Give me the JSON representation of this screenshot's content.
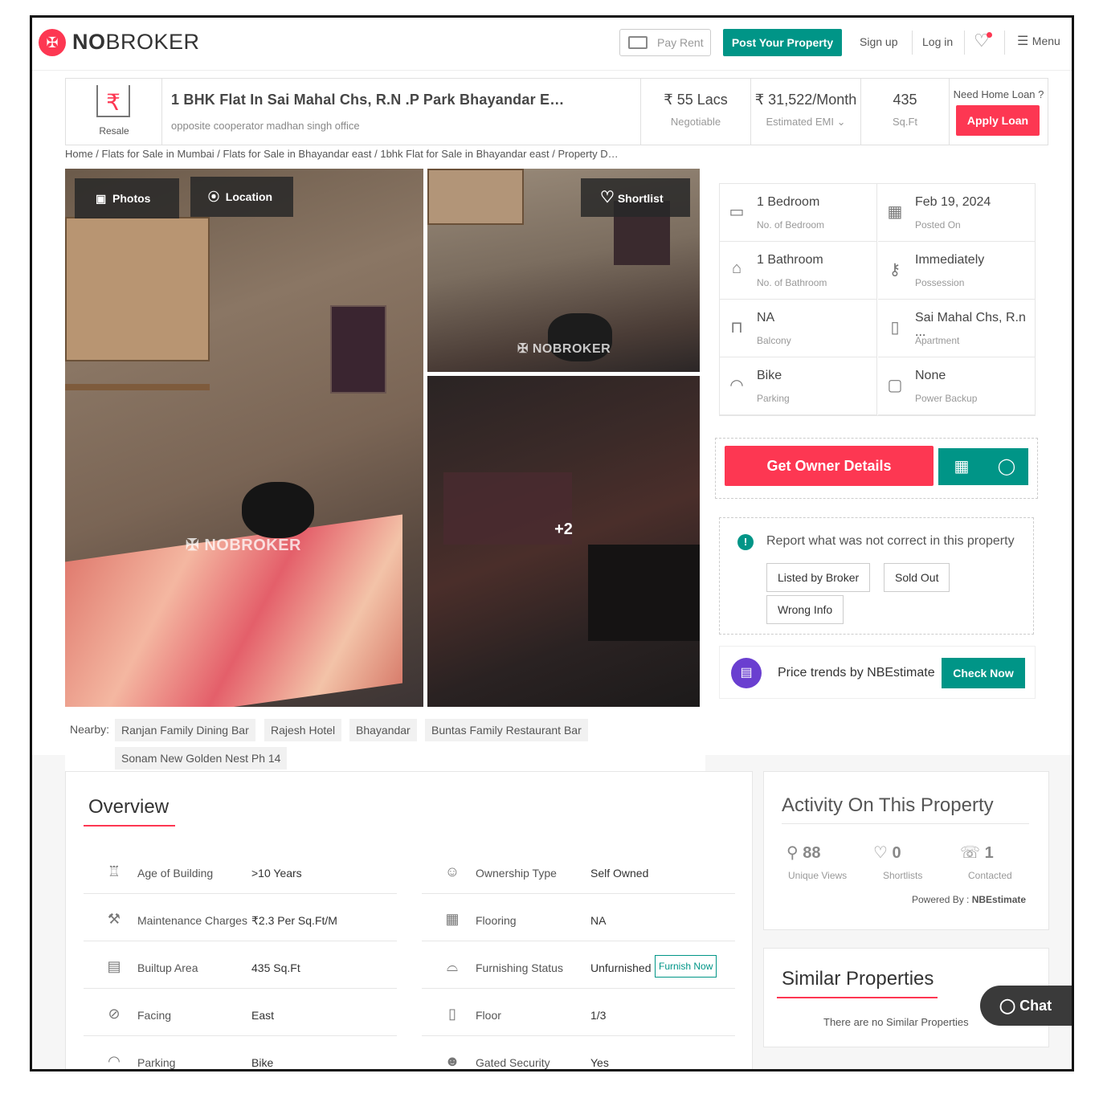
{
  "header": {
    "logo_text_bold": "NO",
    "logo_text_rest": "BROKER",
    "pay_rent": "Pay Rent",
    "post_property": "Post Your Property",
    "sign_up": "Sign up",
    "log_in": "Log in",
    "menu": "Menu"
  },
  "summary": {
    "tag": "Resale",
    "title": "1 BHK Flat In Sai Mahal Chs, R.N .P Park Bhayandar E…",
    "subtitle": "opposite cooperator madhan singh office",
    "price": "₹ 55 Lacs",
    "price_label": "Negotiable",
    "emi": "₹ 31,522/Month",
    "emi_label": "Estimated EMI",
    "area": "435",
    "area_label": "Sq.Ft",
    "loan_question": "Need Home Loan ?",
    "apply_loan": "Apply Loan"
  },
  "breadcrumb": "Home / Flats for Sale in Mumbai / Flats for Sale in Bhayandar east / 1bhk Flat for Sale in Bhayandar east / Property D…",
  "gallery": {
    "photos": "Photos",
    "location": "Location",
    "shortlist": "Shortlist",
    "more": "+2",
    "watermark": "NOBROKER"
  },
  "details": [
    {
      "value": "1 Bedroom",
      "label": "No. of Bedroom",
      "icon": "bed-icon"
    },
    {
      "value": "Feb 19, 2024",
      "label": "Posted On",
      "icon": "calendar-icon"
    },
    {
      "value": "1 Bathroom",
      "label": "No. of Bathroom",
      "icon": "bathtub-icon"
    },
    {
      "value": "Immediately",
      "label": "Possession",
      "icon": "key-icon"
    },
    {
      "value": "NA",
      "label": "Balcony",
      "icon": "balcony-icon"
    },
    {
      "value": "Sai Mahal Chs, R.n ...",
      "label": "Apartment",
      "icon": "building-icon"
    },
    {
      "value": "Bike",
      "label": "Parking",
      "icon": "car-icon"
    },
    {
      "value": "None",
      "label": "Power Backup",
      "icon": "battery-icon"
    }
  ],
  "cta": {
    "owner": "Get Owner Details"
  },
  "report": {
    "title": "Report what was not correct in this property",
    "options": [
      "Listed by Broker",
      "Sold Out",
      "Wrong Info"
    ]
  },
  "trend": {
    "text": "Price trends by NBEstimate",
    "button": "Check Now"
  },
  "nearby": {
    "label": "Nearby:",
    "places": [
      "Ranjan Family Dining Bar",
      "Rajesh Hotel",
      "Bhayandar",
      "Buntas Family Restaurant Bar",
      "Sonam New Golden Nest Ph 14"
    ]
  },
  "overview": {
    "title": "Overview",
    "left": [
      {
        "key": "Age of Building",
        "value": ">10 Years",
        "icon": "building-age-icon"
      },
      {
        "key": "Maintenance Charges",
        "value": "₹2.3 Per Sq.Ft/M",
        "icon": "tools-icon"
      },
      {
        "key": "Builtup Area",
        "value": "435 Sq.Ft",
        "icon": "area-icon"
      },
      {
        "key": "Facing",
        "value": "East",
        "icon": "compass-icon"
      },
      {
        "key": "Parking",
        "value": "Bike",
        "icon": "car-icon"
      }
    ],
    "right": [
      {
        "key": "Ownership Type",
        "value": "Self Owned",
        "icon": "owner-icon"
      },
      {
        "key": "Flooring",
        "value": "NA",
        "icon": "flooring-icon"
      },
      {
        "key": "Furnishing Status",
        "value": "Unfurnished",
        "icon": "sofa-icon"
      },
      {
        "key": "Floor",
        "value": "1/3",
        "icon": "floor-icon"
      },
      {
        "key": "Gated Security",
        "value": "Yes",
        "icon": "guard-icon"
      }
    ],
    "furnish_now": "Furnish Now"
  },
  "activity": {
    "title": "Activity On This Property",
    "views": "88",
    "views_label": "Unique Views",
    "shortlists": "0",
    "shortlists_label": "Shortlists",
    "contacted": "1",
    "contacted_label": "Contacted",
    "powered_by": "Powered By :",
    "powered_by_name": "NBEstimate"
  },
  "similar": {
    "title": "Similar Properties",
    "empty": "There are no Similar Properties"
  },
  "chat": "Chat",
  "colors": {
    "brand_red": "#fd3752",
    "brand_green": "#009587"
  }
}
